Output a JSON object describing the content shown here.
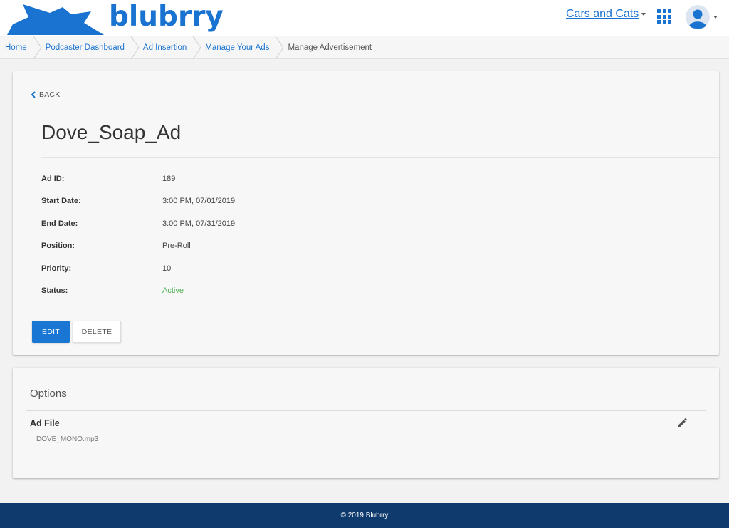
{
  "header": {
    "logo_text": "blubrry",
    "account_name": "Cars and Cats",
    "brand_color": "#1a73d1",
    "icons": [
      "apps-grid-icon",
      "user-avatar-icon",
      "caret-down-icon"
    ]
  },
  "breadcrumb": {
    "items": [
      {
        "label": "Home",
        "link": true
      },
      {
        "label": "Podcaster Dashboard",
        "link": true
      },
      {
        "label": "Ad Insertion",
        "link": true
      },
      {
        "label": "Manage Your Ads",
        "link": true
      },
      {
        "label": "Manage Advertisement",
        "link": false
      }
    ]
  },
  "main": {
    "back_label": "BACK",
    "title": "Dove_Soap_Ad",
    "details": [
      {
        "label": "Ad ID:",
        "value": "189"
      },
      {
        "label": "Start Date:",
        "value": "3:00 PM, 07/01/2019"
      },
      {
        "label": "End Date:",
        "value": "3:00 PM, 07/31/2019"
      },
      {
        "label": "Position:",
        "value": "Pre-Roll"
      },
      {
        "label": "Priority:",
        "value": "10"
      },
      {
        "label": "Status:",
        "value": "Active"
      }
    ],
    "status_color": "#4caf50",
    "edit_label": "EDIT",
    "delete_label": "DELETE",
    "primary_color": "#1976d2"
  },
  "options": {
    "title": "Options",
    "ad_file_label": "Ad File",
    "ad_file_value": "DOVE_MONO.mp3"
  },
  "footer": {
    "text": "© 2019 Blubrry",
    "color": "#0e3a6e"
  }
}
